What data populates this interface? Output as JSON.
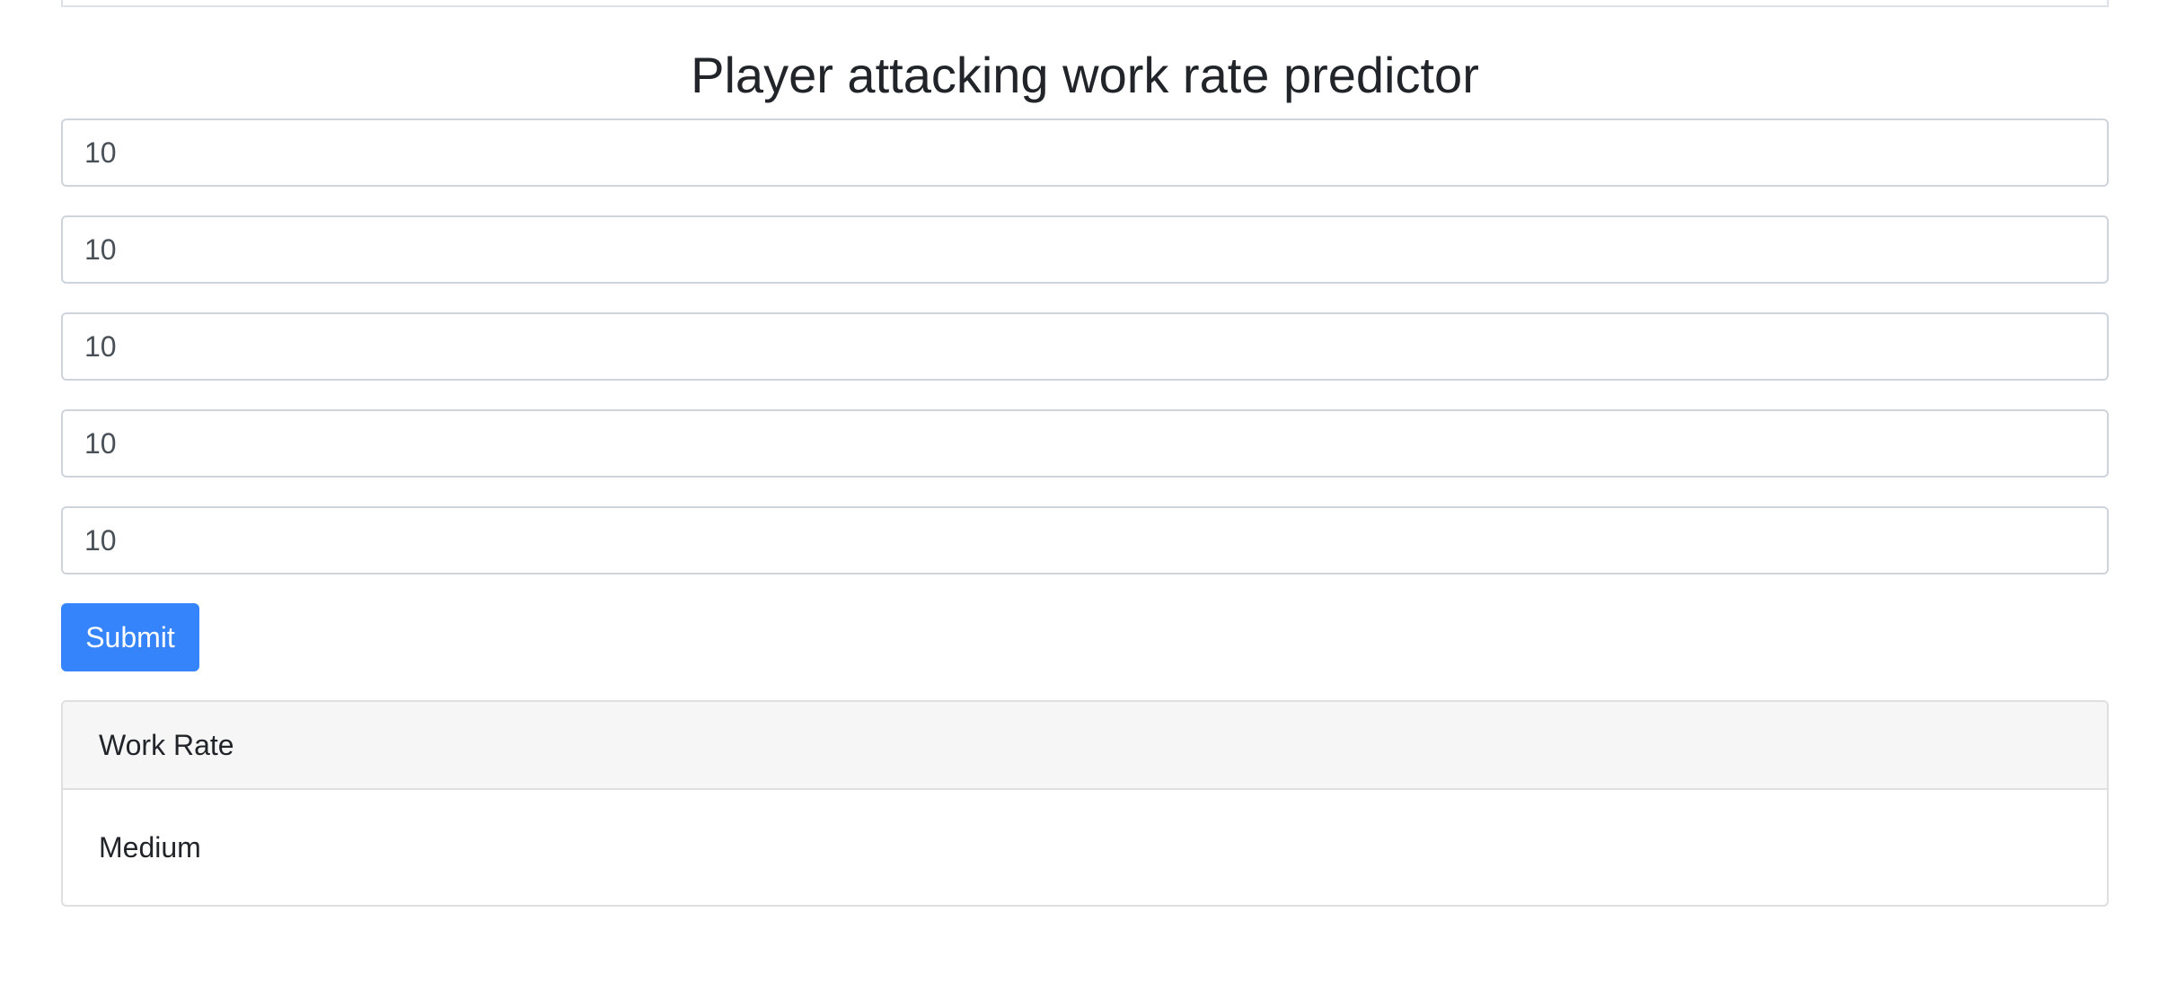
{
  "page": {
    "title": "Player attacking work rate predictor"
  },
  "form": {
    "fields": [
      {
        "value": "10"
      },
      {
        "value": "10"
      },
      {
        "value": "10"
      },
      {
        "value": "10"
      },
      {
        "value": "10"
      }
    ],
    "submit_label": "Submit"
  },
  "result": {
    "header": "Work Rate",
    "value": "Medium"
  },
  "colors": {
    "primary": "#3584fc",
    "text": "#212529",
    "input_border": "#ced4da",
    "card_header_bg": "#f6f6f6"
  }
}
